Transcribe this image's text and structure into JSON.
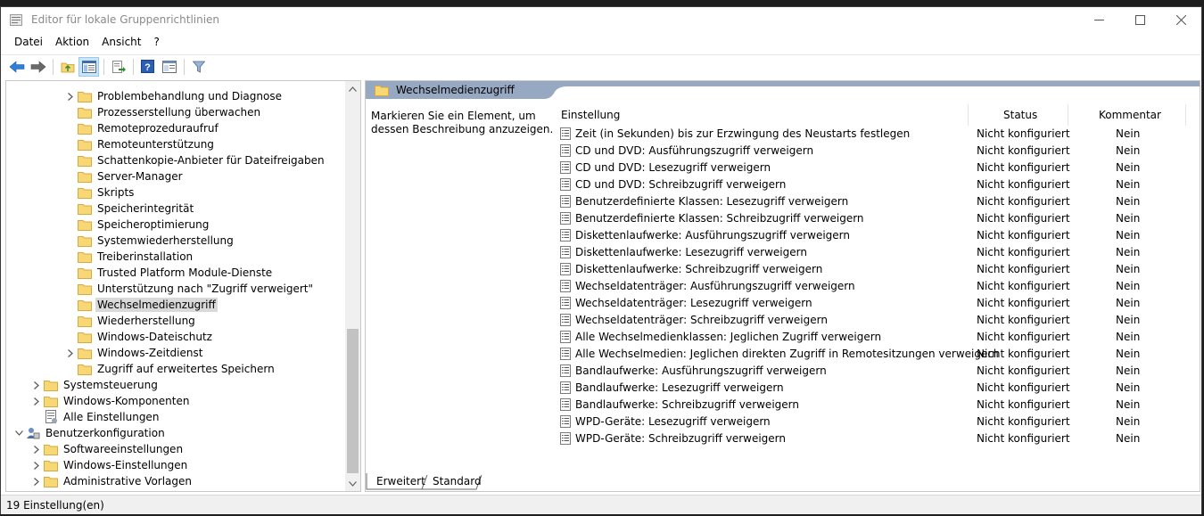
{
  "window": {
    "title": "Editor für lokale Gruppenrichtlinien"
  },
  "menu": [
    "Datei",
    "Aktion",
    "Ansicht",
    "?"
  ],
  "toolbar": {
    "buttons": [
      "back-arrow-icon",
      "forward-arrow-icon",
      "up-folder-icon",
      "show-hide-tree-icon",
      "export-list-icon",
      "help-icon",
      "properties-view-icon",
      "filter-icon"
    ]
  },
  "tree": [
    {
      "label": "Problembehandlung und Diagnose",
      "level": 2,
      "expandable": true,
      "selected": false,
      "icon": "folder"
    },
    {
      "label": "Prozesserstellung überwachen",
      "level": 2,
      "expandable": false,
      "selected": false,
      "icon": "folder"
    },
    {
      "label": "Remoteprozeduraufruf",
      "level": 2,
      "expandable": false,
      "selected": false,
      "icon": "folder"
    },
    {
      "label": "Remoteunterstützung",
      "level": 2,
      "expandable": false,
      "selected": false,
      "icon": "folder"
    },
    {
      "label": "Schattenkopie-Anbieter für Dateifreigaben",
      "level": 2,
      "expandable": false,
      "selected": false,
      "icon": "folder"
    },
    {
      "label": "Server-Manager",
      "level": 2,
      "expandable": false,
      "selected": false,
      "icon": "folder"
    },
    {
      "label": "Skripts",
      "level": 2,
      "expandable": false,
      "selected": false,
      "icon": "folder"
    },
    {
      "label": "Speicherintegrität",
      "level": 2,
      "expandable": false,
      "selected": false,
      "icon": "folder"
    },
    {
      "label": "Speicheroptimierung",
      "level": 2,
      "expandable": false,
      "selected": false,
      "icon": "folder"
    },
    {
      "label": "Systemwiederherstellung",
      "level": 2,
      "expandable": false,
      "selected": false,
      "icon": "folder"
    },
    {
      "label": "Treiberinstallation",
      "level": 2,
      "expandable": false,
      "selected": false,
      "icon": "folder"
    },
    {
      "label": "Trusted Platform Module-Dienste",
      "level": 2,
      "expandable": false,
      "selected": false,
      "icon": "folder"
    },
    {
      "label": "Unterstützung nach \"Zugriff verweigert\"",
      "level": 2,
      "expandable": false,
      "selected": false,
      "icon": "folder"
    },
    {
      "label": "Wechselmedienzugriff",
      "level": 2,
      "expandable": false,
      "selected": true,
      "icon": "folder"
    },
    {
      "label": "Wiederherstellung",
      "level": 2,
      "expandable": false,
      "selected": false,
      "icon": "folder"
    },
    {
      "label": "Windows-Dateischutz",
      "level": 2,
      "expandable": false,
      "selected": false,
      "icon": "folder"
    },
    {
      "label": "Windows-Zeitdienst",
      "level": 2,
      "expandable": true,
      "selected": false,
      "icon": "folder"
    },
    {
      "label": "Zugriff auf erweitertes Speichern",
      "level": 2,
      "expandable": false,
      "selected": false,
      "icon": "folder"
    },
    {
      "label": "Systemsteuerung",
      "level": 1,
      "expandable": true,
      "selected": false,
      "icon": "folder"
    },
    {
      "label": "Windows-Komponenten",
      "level": 1,
      "expandable": true,
      "selected": false,
      "icon": "folder"
    },
    {
      "label": "Alle Einstellungen",
      "level": 1,
      "expandable": false,
      "selected": false,
      "icon": "settings"
    },
    {
      "label": "Benutzerkonfiguration",
      "level": 0,
      "expandable": true,
      "expanded": true,
      "selected": false,
      "icon": "user"
    },
    {
      "label": "Softwareeinstellungen",
      "level": 1,
      "expandable": true,
      "selected": false,
      "icon": "folder"
    },
    {
      "label": "Windows-Einstellungen",
      "level": 1,
      "expandable": true,
      "selected": false,
      "icon": "folder"
    },
    {
      "label": "Administrative Vorlagen",
      "level": 1,
      "expandable": true,
      "selected": false,
      "icon": "folder"
    }
  ],
  "content": {
    "header": "Wechselmedienzugriff",
    "description": "Markieren Sie ein Element, um dessen Beschreibung anzuzeigen.",
    "columns": {
      "setting": "Einstellung",
      "status": "Status",
      "comment": "Kommentar"
    },
    "rows": [
      {
        "name": "Zeit (in Sekunden) bis zur Erzwingung des Neustarts festlegen",
        "status": "Nicht konfiguriert",
        "comment": "Nein"
      },
      {
        "name": "CD und DVD: Ausführungszugriff verweigern",
        "status": "Nicht konfiguriert",
        "comment": "Nein"
      },
      {
        "name": "CD und DVD: Lesezugriff verweigern",
        "status": "Nicht konfiguriert",
        "comment": "Nein"
      },
      {
        "name": "CD und DVD: Schreibzugriff verweigern",
        "status": "Nicht konfiguriert",
        "comment": "Nein"
      },
      {
        "name": "Benutzerdefinierte Klassen: Lesezugriff verweigern",
        "status": "Nicht konfiguriert",
        "comment": "Nein"
      },
      {
        "name": "Benutzerdefinierte Klassen: Schreibzugriff verweigern",
        "status": "Nicht konfiguriert",
        "comment": "Nein"
      },
      {
        "name": "Diskettenlaufwerke: Ausführungszugriff verweigern",
        "status": "Nicht konfiguriert",
        "comment": "Nein"
      },
      {
        "name": "Diskettenlaufwerke: Lesezugriff verweigern",
        "status": "Nicht konfiguriert",
        "comment": "Nein"
      },
      {
        "name": "Diskettenlaufwerke: Schreibzugriff verweigern",
        "status": "Nicht konfiguriert",
        "comment": "Nein"
      },
      {
        "name": "Wechseldatenträger: Ausführungszugriff verweigern",
        "status": "Nicht konfiguriert",
        "comment": "Nein"
      },
      {
        "name": "Wechseldatenträger: Lesezugriff verweigern",
        "status": "Nicht konfiguriert",
        "comment": "Nein"
      },
      {
        "name": "Wechseldatenträger: Schreibzugriff verweigern",
        "status": "Nicht konfiguriert",
        "comment": "Nein"
      },
      {
        "name": "Alle Wechselmedienklassen: Jeglichen Zugriff verweigern",
        "status": "Nicht konfiguriert",
        "comment": "Nein"
      },
      {
        "name": "Alle Wechselmedien: Jeglichen direkten Zugriff in Remotesitzungen verweigern",
        "status": "Nicht konfiguriert",
        "comment": "Nein"
      },
      {
        "name": "Bandlaufwerke: Ausführungszugriff verweigern",
        "status": "Nicht konfiguriert",
        "comment": "Nein"
      },
      {
        "name": "Bandlaufwerke: Lesezugriff verweigern",
        "status": "Nicht konfiguriert",
        "comment": "Nein"
      },
      {
        "name": "Bandlaufwerke: Schreibzugriff verweigern",
        "status": "Nicht konfiguriert",
        "comment": "Nein"
      },
      {
        "name": "WPD-Geräte: Lesezugriff verweigern",
        "status": "Nicht konfiguriert",
        "comment": "Nein"
      },
      {
        "name": "WPD-Geräte: Schreibzugriff verweigern",
        "status": "Nicht konfiguriert",
        "comment": "Nein"
      }
    ],
    "tabs": [
      "Erweitert",
      "Standard"
    ],
    "active_tab": "Erweitert"
  },
  "statusbar": {
    "text": "19 Einstellung(en)"
  },
  "colors": {
    "header_bg": "#97a8c2",
    "folder_fill": "#f8d775",
    "folder_edge": "#d9a93c",
    "selected_bg": "#d9d9d9"
  }
}
